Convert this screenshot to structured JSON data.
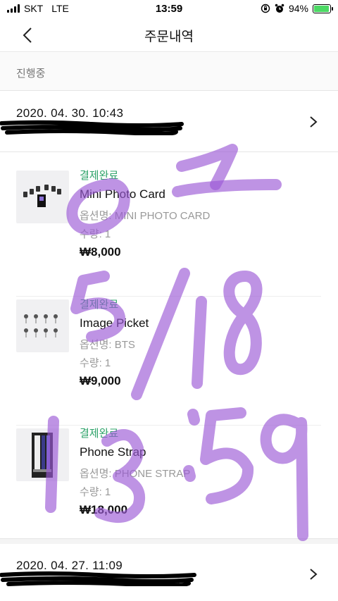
{
  "status_bar": {
    "carrier": "SKT",
    "network": "LTE",
    "time": "13:59",
    "battery": "94%",
    "battery_level": 0.94
  },
  "nav": {
    "title": "주문내역"
  },
  "section": {
    "label": "진행중"
  },
  "orders": [
    {
      "date": "2020. 04. 30. 10:43",
      "items": [
        {
          "status": "결제완료",
          "name": "Mini Photo Card",
          "option": "옵션명: MINI PHOTO CARD",
          "qty": "수량: 1",
          "price": "₩8,000"
        },
        {
          "status": "결제완료",
          "name": "Image Picket",
          "option": "옵션명: BTS",
          "qty": "수량: 1",
          "price": "₩9,000"
        },
        {
          "status": "결제완료",
          "name": "Phone Strap",
          "option": "옵션명: PHONE STRAP",
          "qty": "수량: 1",
          "price": "₩18,000"
        }
      ]
    },
    {
      "date": "2020. 04. 27. 11:09"
    }
  ],
  "colors": {
    "status_green": "#2fa36a",
    "scribble_purple": "#9b59d6",
    "redaction": "#000000"
  },
  "icons": {
    "back": "chevron-left-icon",
    "order_arrow": "chevron-right-icon"
  }
}
